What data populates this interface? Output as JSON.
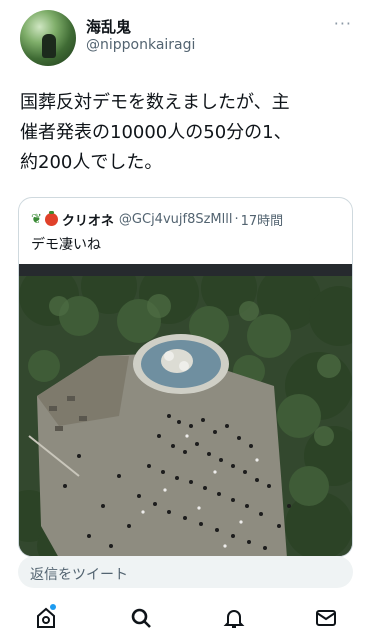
{
  "author": {
    "name": "海乱鬼",
    "handle": "@nipponkairagi",
    "more": "···"
  },
  "tweet": {
    "text": "国葬反対デモを数えましたが、主\n催者発表の10000人の50分の1、\n約200人でした。"
  },
  "quoted": {
    "name": "クリオネ",
    "handle": "@GCj4vujf8SzMlll",
    "separator": "·",
    "time": "17時間",
    "text": "デモ凄いね",
    "sprout": "❦"
  },
  "reply": {
    "placeholder": "返信をツイート"
  },
  "nav": {
    "items": [
      "home-icon",
      "search-icon",
      "bell-icon",
      "mail-icon"
    ],
    "accent": "#1d9bf0"
  }
}
